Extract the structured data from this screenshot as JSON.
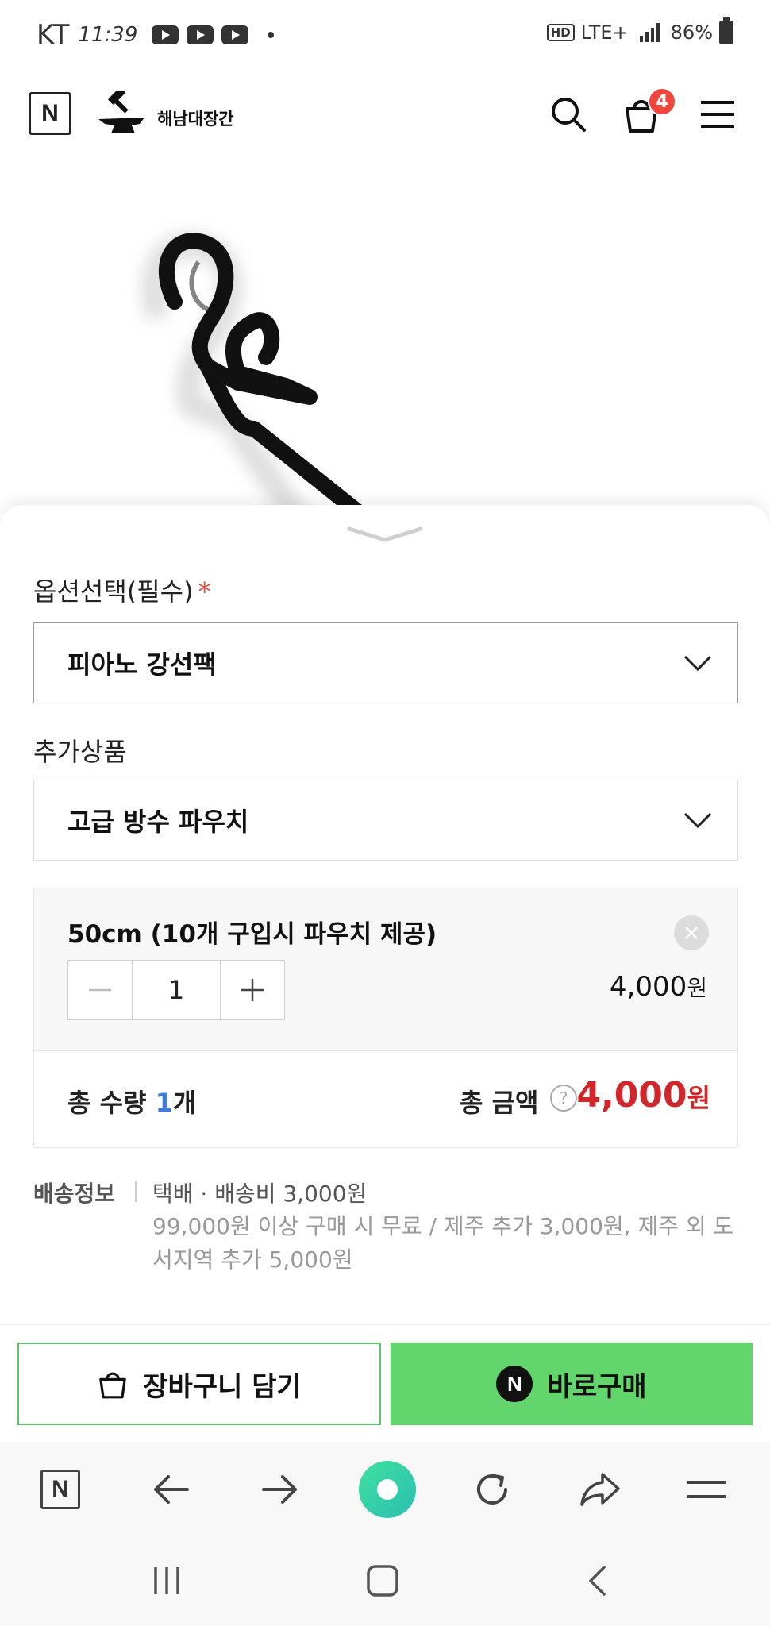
{
  "status_bar": {
    "carrier": "KT",
    "time": "11:39",
    "network": "LTE+",
    "battery": "86%"
  },
  "header": {
    "logo_letter": "N",
    "brand_name": "해남대장간",
    "cart_count": "4"
  },
  "options": {
    "required_label": "옵션선택(필수)",
    "required_mark": "*",
    "required_selected": "피아노 강선팩",
    "addon_label": "추가상품",
    "addon_selected": "고급 방수 파우치"
  },
  "selected_item": {
    "name": "50cm (10개 구입시 파우치 제공)",
    "quantity": "1",
    "price": "4,000",
    "currency": "원"
  },
  "totals": {
    "qty_prefix": "총 수량 ",
    "qty_value": "1",
    "qty_suffix": "개",
    "amount_label": "총 금액",
    "help": "?",
    "amount": "4,000",
    "currency": "원"
  },
  "shipping": {
    "label": "배송정보",
    "main": "택배 · 배송비 3,000원",
    "detail": "99,000원 이상 구매 시 무료 / 제주 추가 3,000원, 제주 외 도서지역 추가 5,000원"
  },
  "actions": {
    "cart_label": "장바구니 담기",
    "buy_letter": "N",
    "buy_label": "바로구매"
  },
  "browser": {
    "home_letter": "N"
  },
  "colors": {
    "accent_green": "#63d56d",
    "price_red": "#d1272b",
    "badge_red": "#f0463c",
    "qty_blue": "#3b7ddd"
  }
}
